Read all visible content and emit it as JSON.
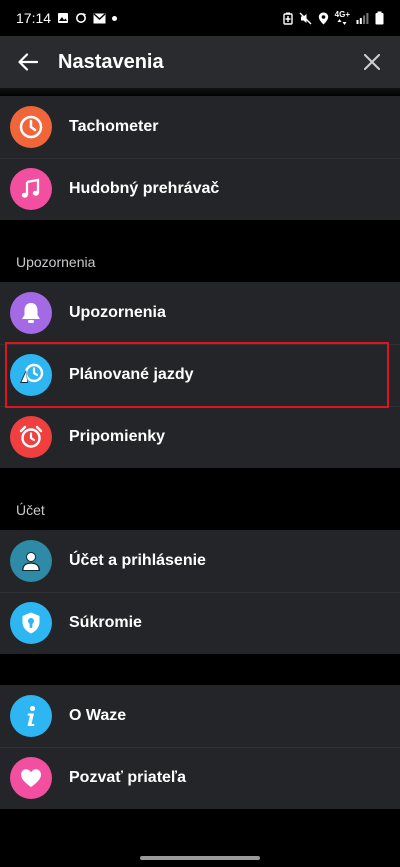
{
  "status_bar": {
    "time": "17:14",
    "network": "4G+"
  },
  "header": {
    "title": "Nastavenia"
  },
  "groups": [
    {
      "items": [
        {
          "label": "Tachometer",
          "icon": "speedometer-icon",
          "color": "#f0663a"
        },
        {
          "label": "Hudobný prehrávač",
          "icon": "music-note-icon",
          "color": "#f24fa0"
        }
      ]
    },
    {
      "section": "Upozornenia",
      "items": [
        {
          "label": "Upozornenia",
          "icon": "bell-icon",
          "color": "#a46ae6"
        },
        {
          "label": "Plánované jazdy",
          "icon": "planned-drive-icon",
          "color": "#2db6f2"
        },
        {
          "label": "Pripomienky",
          "icon": "alarm-clock-icon",
          "color": "#ef3f3f"
        }
      ]
    },
    {
      "section": "Účet",
      "items": [
        {
          "label": "Účet a prihlásenie",
          "icon": "person-icon",
          "color": "#2e8aa6"
        },
        {
          "label": "Súkromie",
          "icon": "privacy-shield-icon",
          "color": "#2db6f2"
        }
      ]
    },
    {
      "items": [
        {
          "label": "O Waze",
          "icon": "info-icon",
          "color": "#2db6f2"
        },
        {
          "label": "Pozvať priateľa",
          "icon": "heart-icon",
          "color": "#f24fa0"
        }
      ]
    }
  ]
}
